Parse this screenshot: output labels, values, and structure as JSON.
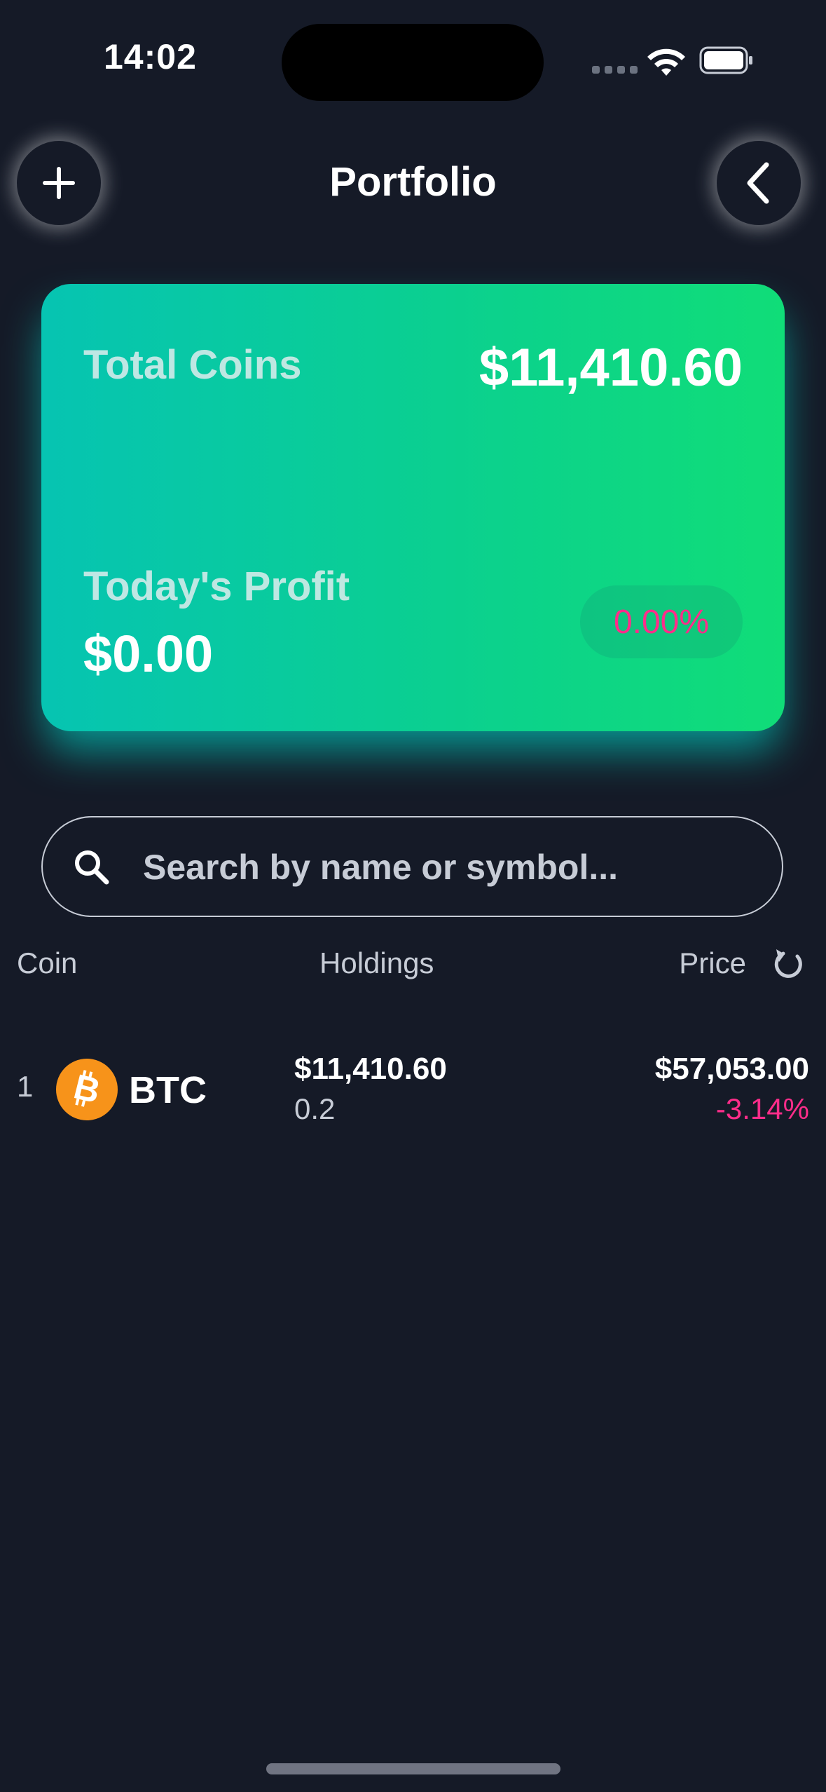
{
  "status_bar": {
    "time": "14:02"
  },
  "header": {
    "title": "Portfolio"
  },
  "summary": {
    "total_label": "Total Coins",
    "total_value": "$11,410.60",
    "profit_label": "Today's Profit",
    "profit_value": "$0.00",
    "profit_percent": "0.00%"
  },
  "search": {
    "placeholder": "Search by name or symbol..."
  },
  "columns": {
    "coin": "Coin",
    "holdings": "Holdings",
    "price": "Price"
  },
  "holdings": [
    {
      "rank": "1",
      "symbol": "BTC",
      "holding_value": "$11,410.60",
      "holding_amount": "0.2",
      "price": "$57,053.00",
      "price_change": "-3.14%"
    }
  ],
  "colors": {
    "background": "#151a27",
    "card_gradient_start": "#06c4b2",
    "card_gradient_end": "#10dd78",
    "negative": "#ff2d8a",
    "bitcoin": "#f7931a"
  },
  "icons": [
    "plus-icon",
    "chevron-left-icon",
    "search-icon",
    "refresh-icon",
    "bitcoin-icon",
    "wifi-icon",
    "battery-icon"
  ]
}
